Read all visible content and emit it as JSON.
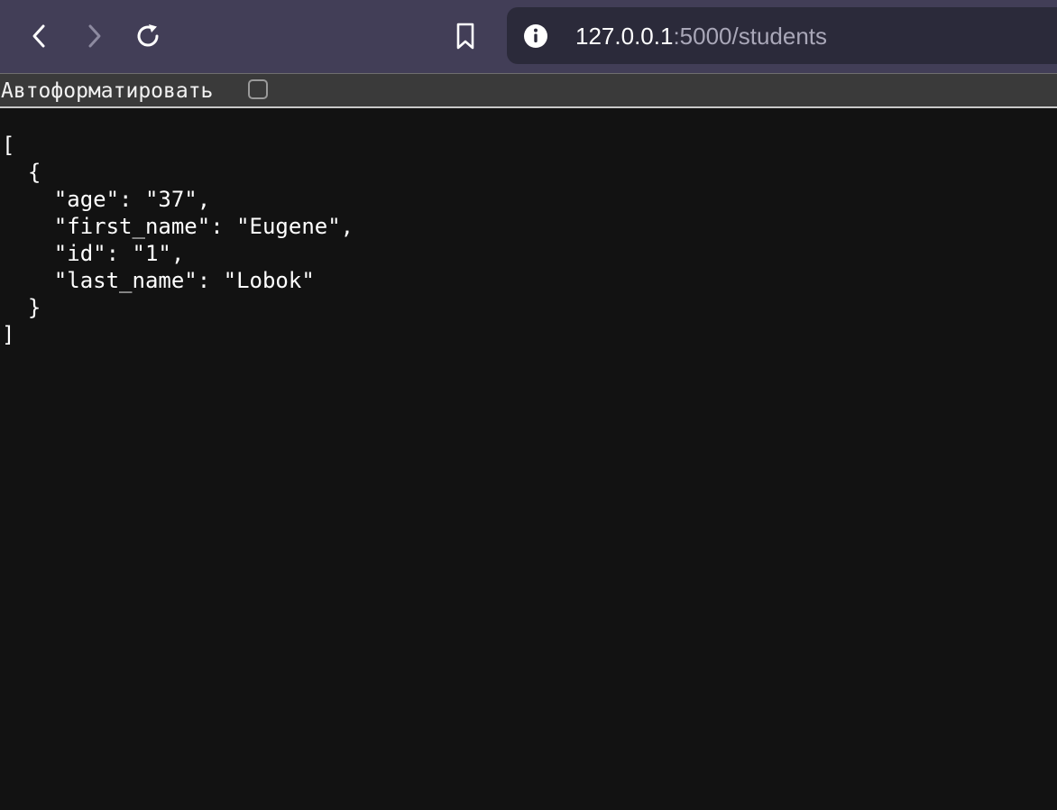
{
  "toolbar": {
    "icons": {
      "back": "chevron-left-icon",
      "forward": "chevron-right-icon",
      "reload": "reload-icon",
      "bookmark": "bookmark-icon",
      "info": "info-icon"
    },
    "url": {
      "host": "127.0.0.1",
      "path": ":5000/students"
    }
  },
  "format_bar": {
    "label": "Автоформатировать",
    "checked": false
  },
  "json_lines": [
    "[",
    "  {",
    "    \"age\": \"37\",",
    "    \"first_name\": \"Eugene\",",
    "    \"id\": \"1\",",
    "    \"last_name\": \"Lobok\"",
    "  }",
    "]"
  ],
  "colors": {
    "toolbar_bg": "#423e57",
    "url_bg": "#2b2a3a",
    "page_bg": "#121212",
    "text": "#ffffff"
  }
}
